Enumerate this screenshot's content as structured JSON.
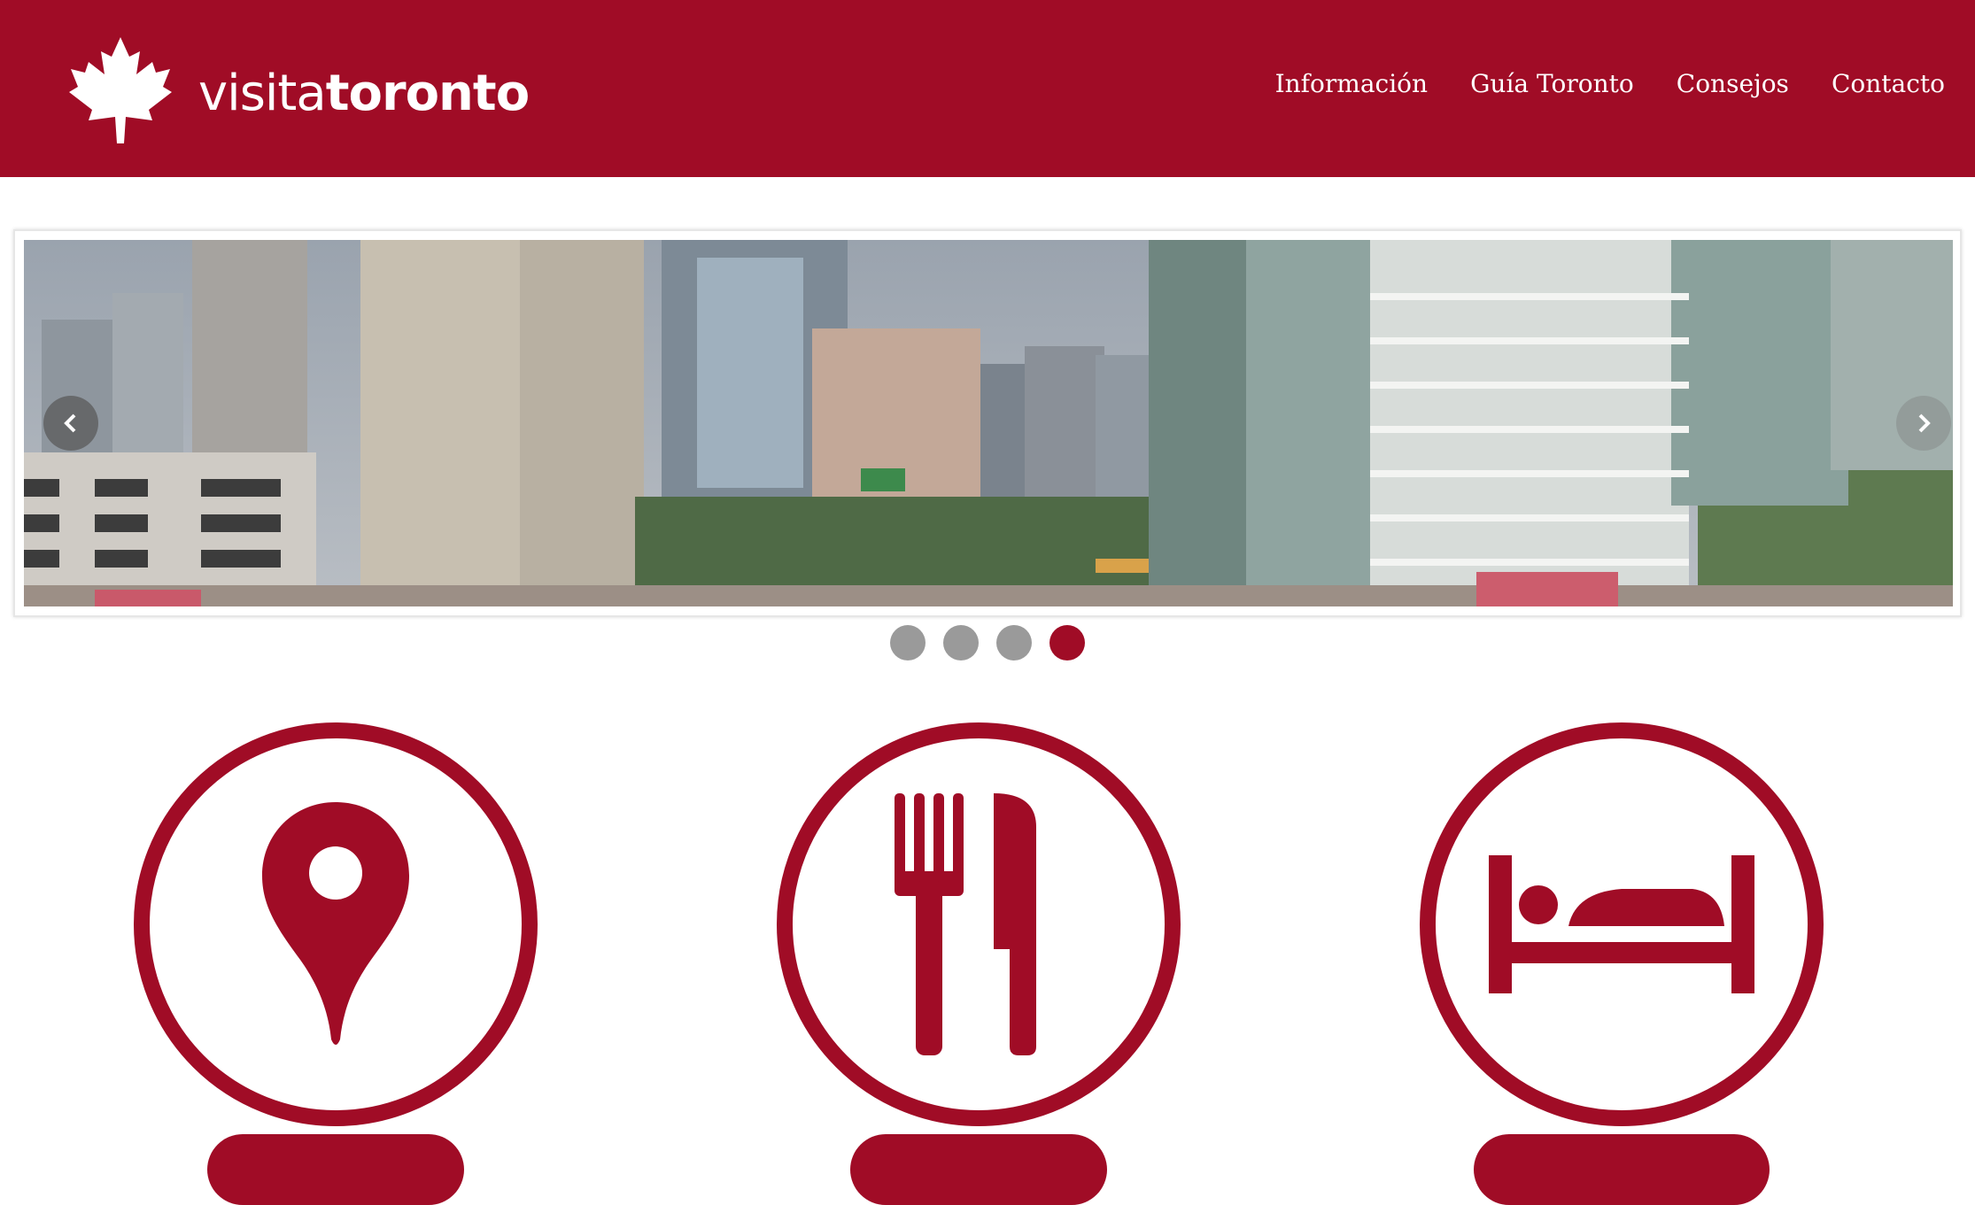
{
  "header": {
    "logo_text_light": "visita",
    "logo_text_bold": "toronto",
    "nav": [
      "Información",
      "Guía Toronto",
      "Consejos",
      "Contacto"
    ]
  },
  "slider": {
    "slide_count": 4,
    "active_slide": 4
  },
  "features": [
    {
      "icon": "location-pin-icon",
      "button_label": ""
    },
    {
      "icon": "fork-knife-icon",
      "button_label": ""
    },
    {
      "icon": "bed-icon",
      "button_label": ""
    }
  ],
  "colors": {
    "brand": "#a00c26",
    "dot_inactive": "#9a9a9a",
    "white": "#ffffff"
  }
}
